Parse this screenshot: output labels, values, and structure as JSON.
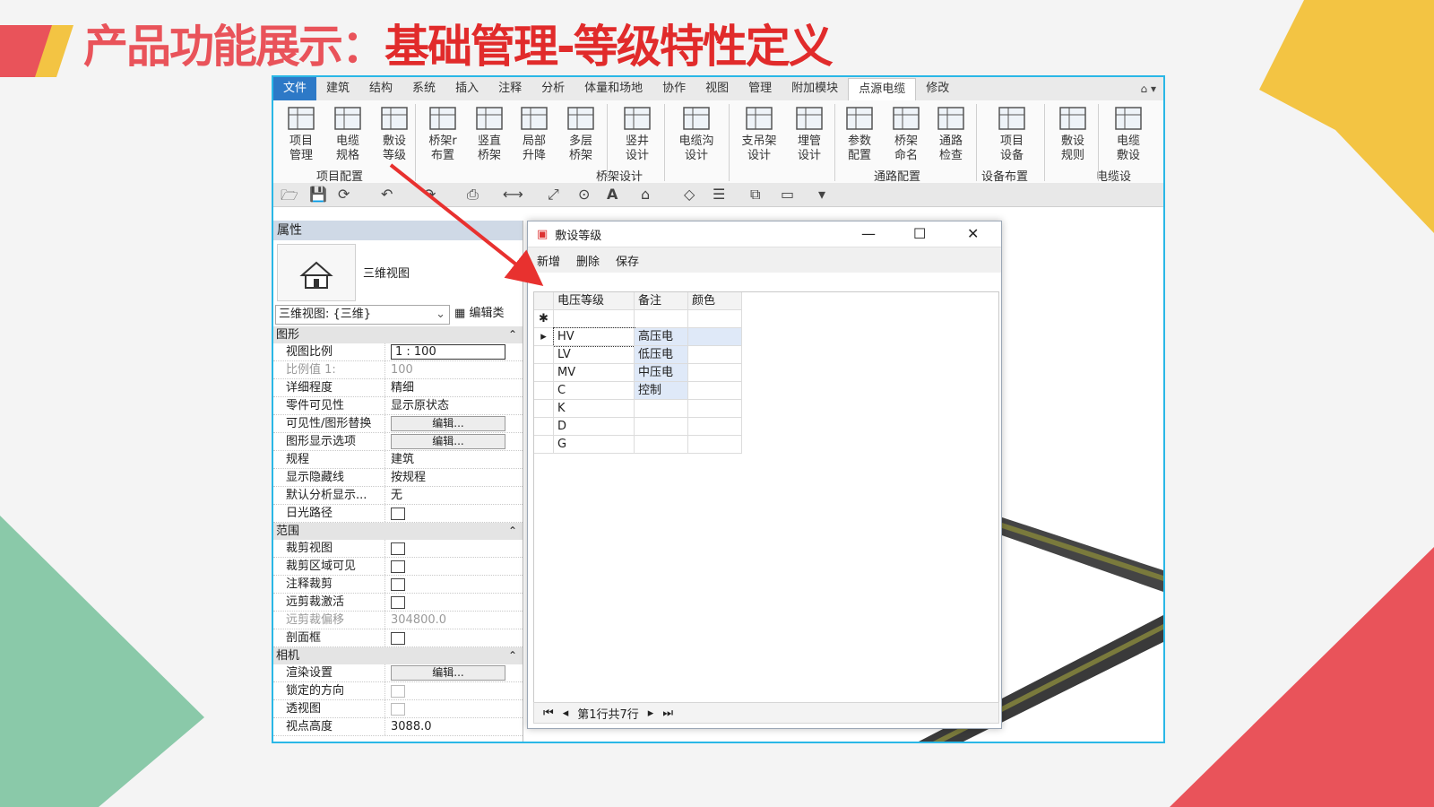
{
  "slide": {
    "title_prefix": "产品功能展示：",
    "title_main": "基础管理-等级特性定义",
    "colors": {
      "red": "#e9535a",
      "yellow": "#f3c443",
      "green": "#8ac9a9",
      "accent_border": "#2ab7e6"
    }
  },
  "ribbon": {
    "tabs": [
      "文件",
      "建筑",
      "结构",
      "系统",
      "插入",
      "注释",
      "分析",
      "体量和场地",
      "协作",
      "视图",
      "管理",
      "附加模块",
      "点源电缆",
      "修改"
    ],
    "active_tab": "点源电缆",
    "buttons": [
      {
        "l1": "项目",
        "l2": "管理"
      },
      {
        "l1": "电缆",
        "l2": "规格"
      },
      {
        "l1": "敷设",
        "l2": "等级"
      },
      {
        "l1": "桥架r",
        "l2": "布置"
      },
      {
        "l1": "竖直",
        "l2": "桥架"
      },
      {
        "l1": "局部",
        "l2": "升降"
      },
      {
        "l1": "多层",
        "l2": "桥架"
      },
      {
        "l1": "竖井",
        "l2": "设计"
      },
      {
        "l1": "电缆沟",
        "l2": "设计"
      },
      {
        "l1": "支吊架",
        "l2": "设计"
      },
      {
        "l1": "埋管",
        "l2": "设计"
      },
      {
        "l1": "参数",
        "l2": "配置"
      },
      {
        "l1": "桥架",
        "l2": "命名"
      },
      {
        "l1": "通路",
        "l2": "检查"
      },
      {
        "l1": "项目",
        "l2": "设备"
      },
      {
        "l1": "敷设",
        "l2": "规则"
      },
      {
        "l1": "电缆",
        "l2": "敷设"
      }
    ],
    "groups": [
      "项目配置",
      "桥架设计",
      "通路配置",
      "设备布置",
      "电缆设"
    ]
  },
  "properties": {
    "header": "属性",
    "type_name": "三维视图",
    "view_selector": "三维视图: {三维}",
    "edit_type": "编辑类",
    "sections": [
      {
        "name": "图形",
        "rows": [
          {
            "k": "视图比例",
            "v": "1 : 100",
            "kind": "box"
          },
          {
            "k": "比例值 1:",
            "v": "100",
            "kind": "gray"
          },
          {
            "k": "详细程度",
            "v": "精细"
          },
          {
            "k": "零件可见性",
            "v": "显示原状态"
          },
          {
            "k": "可见性/图形替换",
            "v": "编辑...",
            "kind": "btn"
          },
          {
            "k": "图形显示选项",
            "v": "编辑...",
            "kind": "btn"
          },
          {
            "k": "规程",
            "v": "建筑"
          },
          {
            "k": "显示隐藏线",
            "v": "按规程"
          },
          {
            "k": "默认分析显示...",
            "v": "无"
          },
          {
            "k": "日光路径",
            "v": "",
            "kind": "cb"
          }
        ]
      },
      {
        "name": "范围",
        "rows": [
          {
            "k": "裁剪视图",
            "v": "",
            "kind": "cb"
          },
          {
            "k": "裁剪区域可见",
            "v": "",
            "kind": "cb"
          },
          {
            "k": "注释裁剪",
            "v": "",
            "kind": "cb"
          },
          {
            "k": "远剪裁激活",
            "v": "",
            "kind": "cb"
          },
          {
            "k": "远剪裁偏移",
            "v": "304800.0",
            "kind": "gray"
          },
          {
            "k": "剖面框",
            "v": "",
            "kind": "cb"
          }
        ]
      },
      {
        "name": "相机",
        "rows": [
          {
            "k": "渲染设置",
            "v": "编辑...",
            "kind": "btn"
          },
          {
            "k": "锁定的方向",
            "v": "",
            "kind": "cbdim"
          },
          {
            "k": "透视图",
            "v": "",
            "kind": "cbdim"
          },
          {
            "k": "视点高度",
            "v": "3088.0"
          }
        ]
      }
    ]
  },
  "dialog": {
    "title": "敷设等级",
    "toolbar": [
      "新增",
      "删除",
      "保存"
    ],
    "columns": [
      "电压等级",
      "备注",
      "颜色"
    ],
    "rows": [
      {
        "level": "HV",
        "note": "高压电",
        "color": ""
      },
      {
        "level": "LV",
        "note": "低压电",
        "color": ""
      },
      {
        "level": "MV",
        "note": "中压电",
        "color": ""
      },
      {
        "level": "C",
        "note": "控制",
        "color": ""
      },
      {
        "level": "K",
        "note": "",
        "color": ""
      },
      {
        "level": "D",
        "note": "",
        "color": ""
      },
      {
        "level": "G",
        "note": "",
        "color": ""
      }
    ],
    "pager": "第1行共7行"
  }
}
